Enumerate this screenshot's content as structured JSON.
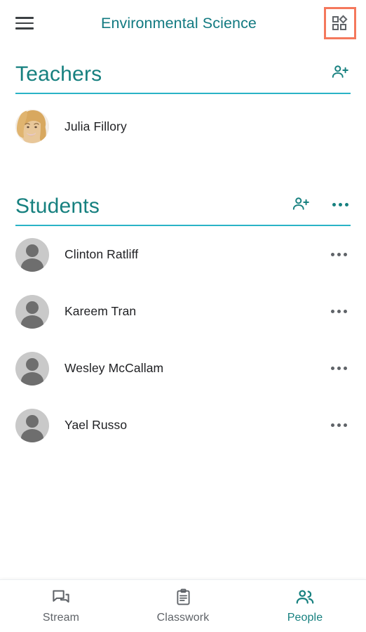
{
  "header": {
    "menu_icon": "hamburger-menu-icon",
    "title": "Environmental Science",
    "grid_icon": "classes-grid-icon",
    "grid_highlight_color": "#f4785c",
    "title_color": "#127a81"
  },
  "theme": {
    "accent_teal": "#16807f",
    "rule_cyan": "#2ab3c6",
    "text_primary": "#202124",
    "icon_gray": "#5f6368"
  },
  "sections": [
    {
      "id": "teachers",
      "title": "Teachers",
      "actions": [
        {
          "name": "invite-teacher-button",
          "icon": "person-add-icon"
        }
      ],
      "people": [
        {
          "name": "Julia Fillory",
          "avatar": "photo",
          "has_more": false
        }
      ]
    },
    {
      "id": "students",
      "title": "Students",
      "actions": [
        {
          "name": "invite-student-button",
          "icon": "person-add-icon"
        },
        {
          "name": "students-overflow-button",
          "icon": "more-horizontal-icon"
        }
      ],
      "people": [
        {
          "name": "Clinton Ratliff",
          "avatar": "placeholder",
          "has_more": true
        },
        {
          "name": "Kareem Tran",
          "avatar": "placeholder",
          "has_more": true
        },
        {
          "name": "Wesley McCallam",
          "avatar": "placeholder",
          "has_more": true
        },
        {
          "name": "Yael Russo",
          "avatar": "placeholder",
          "has_more": true
        }
      ]
    }
  ],
  "bottom_nav": {
    "items": [
      {
        "label": "Stream",
        "icon": "forum-icon",
        "active": false
      },
      {
        "label": "Classwork",
        "icon": "clipboard-icon",
        "active": false
      },
      {
        "label": "People",
        "icon": "people-icon",
        "active": true
      }
    ]
  }
}
